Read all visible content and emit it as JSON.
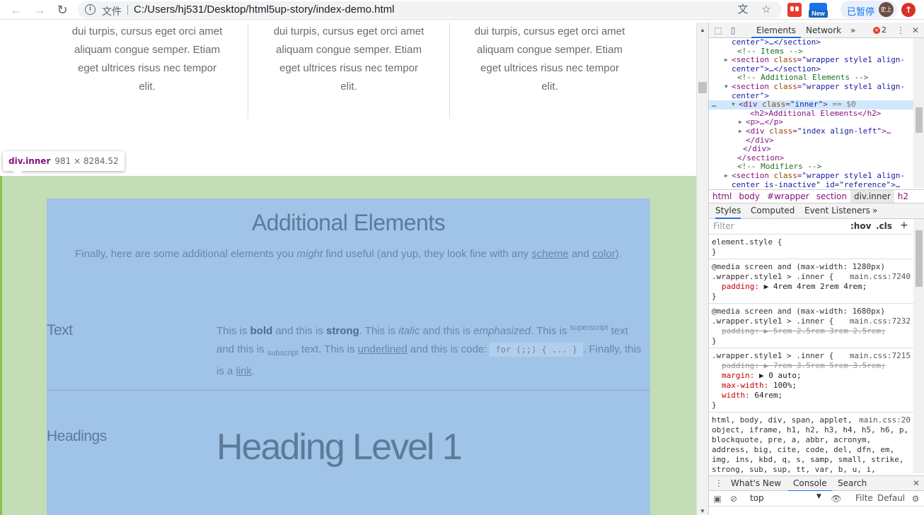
{
  "browser": {
    "file_label": "文件",
    "url": "C:/Users/hj531/Desktop/html5up-story/index-demo.html",
    "ext_new_label": "New",
    "paused_label": "已暂停",
    "avatar_label": "史上",
    "update_label": "↑"
  },
  "page": {
    "columns": [
      {
        "lines": [
          "dui turpis, cursus eget orci amet",
          "aliquam congue semper. Etiam",
          "eget ultrices risus nec tempor",
          "elit."
        ]
      },
      {
        "lines": [
          "dui turpis, cursus eget orci amet",
          "aliquam congue semper. Etiam",
          "eget ultrices risus nec tempor",
          "elit."
        ]
      },
      {
        "lines": [
          "dui turpis, cursus eget orci amet",
          "aliquam congue semper. Etiam",
          "eget ultrices risus nec tempor",
          "elit."
        ]
      }
    ],
    "tooltip": {
      "name": "div.inner",
      "size": "981 × 8284.52"
    },
    "section_title": "Additional Elements",
    "lead": {
      "before": "Finally, here are some additional elements you ",
      "em": "might",
      "mid1": " find useful (and yup, they look fine with any ",
      "link1": "scheme",
      "mid2": " and ",
      "link2": "color",
      "after": ")."
    },
    "text_label": "Text",
    "text_para": {
      "t1": "This is ",
      "bold": "bold",
      "t2": " and this is ",
      "strong": "strong",
      "t3": ". This is ",
      "italic": "italic",
      "t4": " and this is ",
      "emph": "emphasized",
      "t5": ". This is ",
      "sup": "superscript",
      "t6": " text and this is ",
      "sub": "subscript",
      "t7": " text. This is ",
      "under": "underlined",
      "t8": " and this is code: ",
      "code": "for (;;) { ... }",
      "t9": ". Finally, this is a ",
      "link": "link",
      "t10": "."
    },
    "headings_label": "Headings",
    "heading1": "Heading Level 1"
  },
  "devtools": {
    "tabs": [
      "Elements",
      "Network",
      "»"
    ],
    "error_count": "2",
    "dom_lines": [
      {
        "indent": 32,
        "arrow": "",
        "html": "center\">…</section>",
        "kind": "val"
      },
      {
        "indent": 40,
        "arrow": "",
        "html": "<!-- Items -->",
        "kind": "cmt"
      },
      {
        "indent": 32,
        "arrow": "▶",
        "html": "<section class=\"wrapper style1 align-",
        "kind": "tag"
      },
      {
        "indent": 32,
        "arrow": "",
        "html": "center\">…</section>",
        "kind": "val"
      },
      {
        "indent": 40,
        "arrow": "",
        "html": "<!-- Additional Elements -->",
        "kind": "cmt"
      },
      {
        "indent": 32,
        "arrow": "▼",
        "html": "<section class=\"wrapper style1 align-",
        "kind": "tag"
      },
      {
        "indent": 32,
        "arrow": "",
        "html": "center\">",
        "kind": "val"
      },
      {
        "indent": 42,
        "arrow": "▼",
        "html": "<div class=\"inner\"> == $0",
        "kind": "sel"
      },
      {
        "indent": 58,
        "arrow": "",
        "html": "<h2>Additional Elements</h2>",
        "kind": "tag"
      },
      {
        "indent": 52,
        "arrow": "▶",
        "html": "<p>…</p>",
        "kind": "tag"
      },
      {
        "indent": 52,
        "arrow": "▶",
        "html": "<div class=\"index align-left\">…",
        "kind": "tag"
      },
      {
        "indent": 52,
        "arrow": "",
        "html": "</div>",
        "kind": "tag"
      },
      {
        "indent": 48,
        "arrow": "",
        "html": "</div>",
        "kind": "tag"
      },
      {
        "indent": 40,
        "arrow": "",
        "html": "</section>",
        "kind": "tag"
      },
      {
        "indent": 40,
        "arrow": "",
        "html": "<!-- Modifiers -->",
        "kind": "cmt"
      },
      {
        "indent": 32,
        "arrow": "▶",
        "html": "<section class=\"wrapper style1 align-",
        "kind": "tag"
      },
      {
        "indent": 32,
        "arrow": "",
        "html": "center is-inactive\" id=\"reference\">…",
        "kind": "val"
      }
    ],
    "breadcrumbs": [
      "html",
      "body",
      "#wrapper",
      "section",
      "div.inner",
      "h2"
    ],
    "sub_tabs": [
      "Styles",
      "Computed",
      "Event Listeners",
      "»"
    ],
    "filter_placeholder": "Filter",
    "hov": ":hov",
    "cls": ".cls",
    "plus": "+",
    "rules": [
      {
        "lines": [
          {
            "text": "element.style {"
          },
          {
            "text": "}"
          }
        ]
      },
      {
        "lines": [
          {
            "text": "@media screen and (max-width: 1280px)"
          },
          {
            "text": ".wrapper.style1 > .inner {",
            "src": "main.css:7240"
          },
          {
            "prop": "padding:",
            "val": "▶ 4rem 4rem 2rem 4rem;"
          },
          {
            "text": "}"
          }
        ]
      },
      {
        "lines": [
          {
            "text": "@media screen and (max-width: 1680px)"
          },
          {
            "text": ".wrapper.style1 > .inner {",
            "src": "main.css:7232"
          },
          {
            "prop": "padding:",
            "val": "▶ 5rem 2.5rem 3rem 2.5rem;",
            "strike": true
          },
          {
            "text": "}"
          }
        ]
      },
      {
        "lines": [
          {
            "text": ".wrapper.style1 > .inner {",
            "src": "main.css:7215"
          },
          {
            "prop": "padding:",
            "val": "▶ 7rem 3.5rem 5rem 3.5rem;",
            "strike": true
          },
          {
            "prop": "margin:",
            "val": "▶ 0 auto;"
          },
          {
            "prop": "max-width:",
            "val": "100%;"
          },
          {
            "prop": "width:",
            "val": "64rem;"
          },
          {
            "text": "}"
          }
        ]
      },
      {
        "lines": [
          {
            "text": "html, body, div, span, applet,",
            "src": "main.css:20"
          },
          {
            "text": "object, iframe, h1, h2, h3, h4, h5, h6, p,"
          },
          {
            "text": "blockquote, pre, a, abbr, acronym,"
          },
          {
            "text": "address, big, cite, code, del, dfn, em,"
          },
          {
            "text": "img, ins, kbd, q, s, samp, small, strike,"
          },
          {
            "text": "strong, sub, sup, tt, var, b, u, i,"
          }
        ]
      }
    ],
    "drawer_tabs": [
      "What's New",
      "Console",
      "Search"
    ],
    "console": {
      "context": "top",
      "filter": "Filte",
      "levels": "Defaul"
    }
  }
}
